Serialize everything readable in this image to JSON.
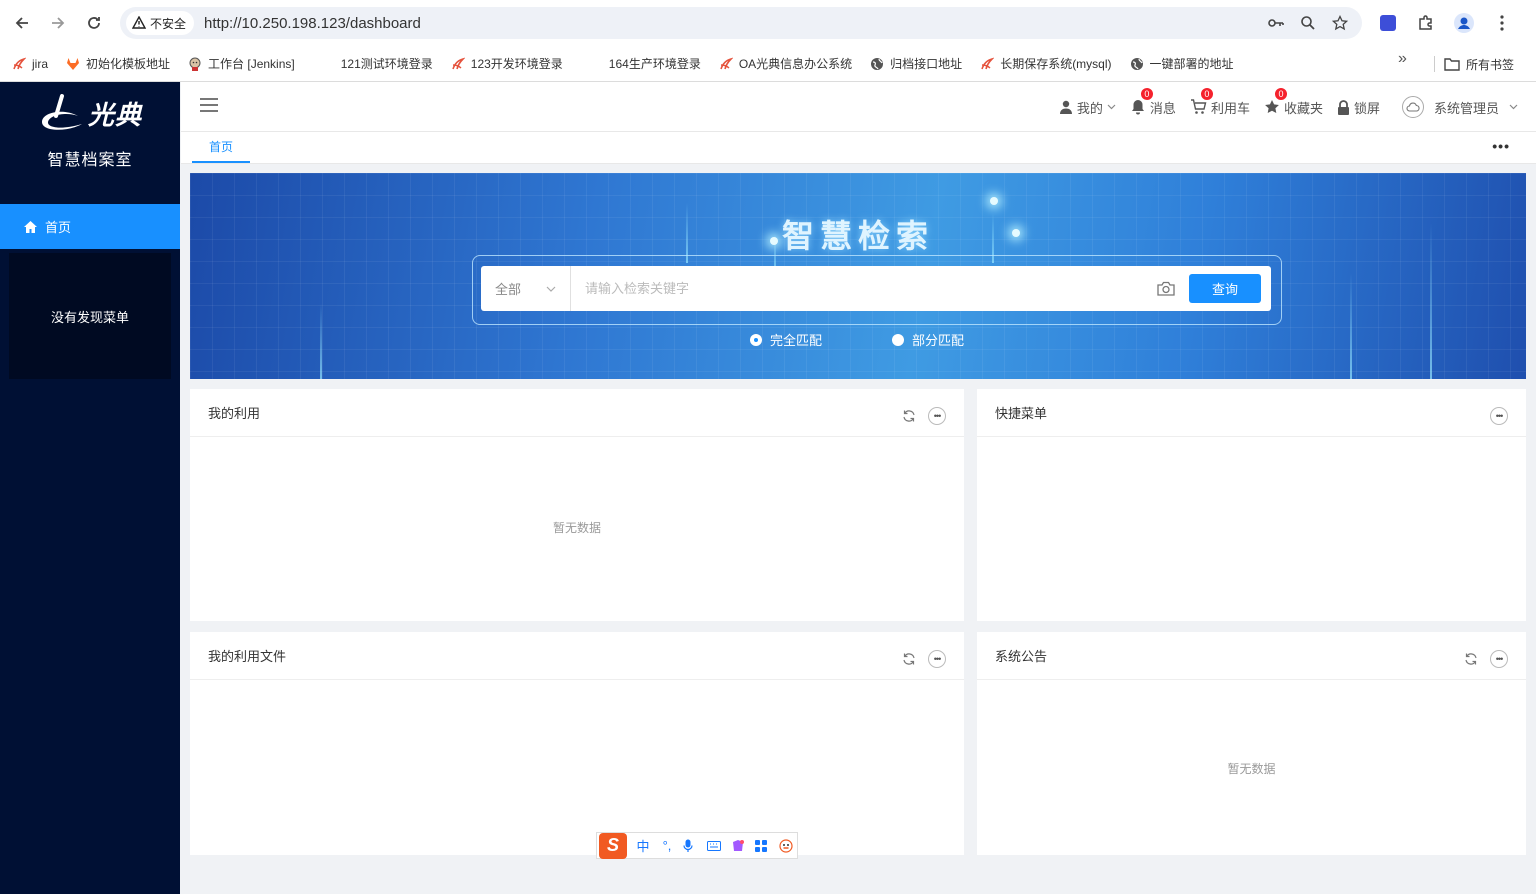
{
  "browser": {
    "security_label": "不安全",
    "url": "http://10.250.198.123/dashboard",
    "bookmarks": [
      {
        "label": "jira",
        "icon": "bookmark-favicon-icon"
      },
      {
        "label": "初始化模板地址",
        "icon": "gitlab-icon"
      },
      {
        "label": "工作台 [Jenkins]",
        "icon": "jenkins-icon"
      },
      {
        "label": "121测试环境登录",
        "icon": "blank-icon"
      },
      {
        "label": "123开发环境登录",
        "icon": "bookmark-favicon-icon"
      },
      {
        "label": "164生产环境登录",
        "icon": "blank-icon"
      },
      {
        "label": "OA光典信息办公系统",
        "icon": "bookmark-favicon-icon"
      },
      {
        "label": "归档接口地址",
        "icon": "globe-icon"
      },
      {
        "label": "长期保存系统(mysql)",
        "icon": "bookmark-favicon-icon"
      },
      {
        "label": "一键部署的地址",
        "icon": "globe-icon"
      }
    ],
    "all_bookmarks": "所有书签"
  },
  "sidebar": {
    "logo_text": "光典",
    "subtitle": "智慧档案室",
    "active_item": "首页",
    "empty_menu": "没有发现菜单"
  },
  "header": {
    "mine": "我的",
    "messages": "消息",
    "messages_count": "0",
    "cart": "利用车",
    "cart_count": "0",
    "favorites": "收藏夹",
    "favorites_count": "0",
    "lock": "锁屏",
    "user": "系统管理员"
  },
  "tabs": [
    {
      "label": "首页"
    }
  ],
  "search": {
    "title": "智慧检索",
    "scope": "全部",
    "placeholder": "请输入检索关键字",
    "button": "查询",
    "options": [
      "完全匹配",
      "部分匹配"
    ],
    "selected": "完全匹配"
  },
  "cards": {
    "my_use": {
      "title": "我的利用",
      "empty": "暂无数据"
    },
    "quick_menu": {
      "title": "快捷菜单"
    },
    "my_files": {
      "title": "我的利用文件"
    },
    "notice": {
      "title": "系统公告",
      "empty": "暂无数据"
    }
  },
  "ime": {
    "mode": "中"
  },
  "colors": {
    "sidebar_bg": "#001034",
    "accent": "#1890ff",
    "badge": "#f5222d"
  }
}
